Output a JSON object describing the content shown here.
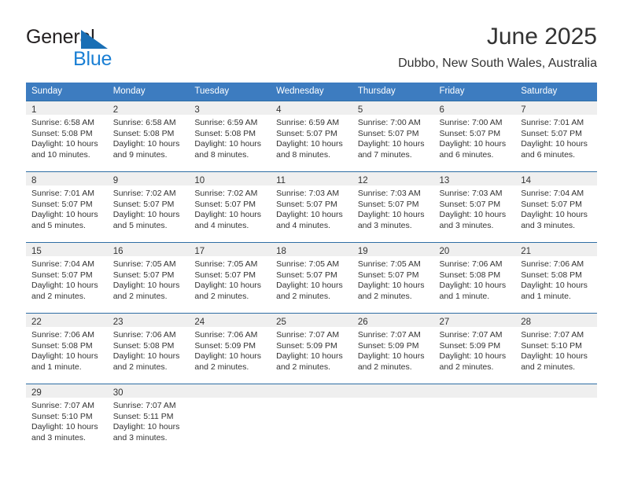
{
  "brand": {
    "name_part1": "General",
    "name_part2": "Blue",
    "logo_icon": "triangle-flag-icon",
    "accent_color": "#1a7fd4"
  },
  "header": {
    "title": "June 2025",
    "location": "Dubbo, New South Wales, Australia"
  },
  "theme": {
    "header_bg": "#3d7cc0",
    "row_border": "#2e6da4",
    "day_band_bg": "#efefef",
    "text_color": "#333333"
  },
  "calendar": {
    "weekday_headers": [
      "Sunday",
      "Monday",
      "Tuesday",
      "Wednesday",
      "Thursday",
      "Friday",
      "Saturday"
    ],
    "weeks": [
      [
        {
          "day": "1",
          "sunrise": "Sunrise: 6:58 AM",
          "sunset": "Sunset: 5:08 PM",
          "daylight_1": "Daylight: 10 hours",
          "daylight_2": "and 10 minutes."
        },
        {
          "day": "2",
          "sunrise": "Sunrise: 6:58 AM",
          "sunset": "Sunset: 5:08 PM",
          "daylight_1": "Daylight: 10 hours",
          "daylight_2": "and 9 minutes."
        },
        {
          "day": "3",
          "sunrise": "Sunrise: 6:59 AM",
          "sunset": "Sunset: 5:08 PM",
          "daylight_1": "Daylight: 10 hours",
          "daylight_2": "and 8 minutes."
        },
        {
          "day": "4",
          "sunrise": "Sunrise: 6:59 AM",
          "sunset": "Sunset: 5:07 PM",
          "daylight_1": "Daylight: 10 hours",
          "daylight_2": "and 8 minutes."
        },
        {
          "day": "5",
          "sunrise": "Sunrise: 7:00 AM",
          "sunset": "Sunset: 5:07 PM",
          "daylight_1": "Daylight: 10 hours",
          "daylight_2": "and 7 minutes."
        },
        {
          "day": "6",
          "sunrise": "Sunrise: 7:00 AM",
          "sunset": "Sunset: 5:07 PM",
          "daylight_1": "Daylight: 10 hours",
          "daylight_2": "and 6 minutes."
        },
        {
          "day": "7",
          "sunrise": "Sunrise: 7:01 AM",
          "sunset": "Sunset: 5:07 PM",
          "daylight_1": "Daylight: 10 hours",
          "daylight_2": "and 6 minutes."
        }
      ],
      [
        {
          "day": "8",
          "sunrise": "Sunrise: 7:01 AM",
          "sunset": "Sunset: 5:07 PM",
          "daylight_1": "Daylight: 10 hours",
          "daylight_2": "and 5 minutes."
        },
        {
          "day": "9",
          "sunrise": "Sunrise: 7:02 AM",
          "sunset": "Sunset: 5:07 PM",
          "daylight_1": "Daylight: 10 hours",
          "daylight_2": "and 5 minutes."
        },
        {
          "day": "10",
          "sunrise": "Sunrise: 7:02 AM",
          "sunset": "Sunset: 5:07 PM",
          "daylight_1": "Daylight: 10 hours",
          "daylight_2": "and 4 minutes."
        },
        {
          "day": "11",
          "sunrise": "Sunrise: 7:03 AM",
          "sunset": "Sunset: 5:07 PM",
          "daylight_1": "Daylight: 10 hours",
          "daylight_2": "and 4 minutes."
        },
        {
          "day": "12",
          "sunrise": "Sunrise: 7:03 AM",
          "sunset": "Sunset: 5:07 PM",
          "daylight_1": "Daylight: 10 hours",
          "daylight_2": "and 3 minutes."
        },
        {
          "day": "13",
          "sunrise": "Sunrise: 7:03 AM",
          "sunset": "Sunset: 5:07 PM",
          "daylight_1": "Daylight: 10 hours",
          "daylight_2": "and 3 minutes."
        },
        {
          "day": "14",
          "sunrise": "Sunrise: 7:04 AM",
          "sunset": "Sunset: 5:07 PM",
          "daylight_1": "Daylight: 10 hours",
          "daylight_2": "and 3 minutes."
        }
      ],
      [
        {
          "day": "15",
          "sunrise": "Sunrise: 7:04 AM",
          "sunset": "Sunset: 5:07 PM",
          "daylight_1": "Daylight: 10 hours",
          "daylight_2": "and 2 minutes."
        },
        {
          "day": "16",
          "sunrise": "Sunrise: 7:05 AM",
          "sunset": "Sunset: 5:07 PM",
          "daylight_1": "Daylight: 10 hours",
          "daylight_2": "and 2 minutes."
        },
        {
          "day": "17",
          "sunrise": "Sunrise: 7:05 AM",
          "sunset": "Sunset: 5:07 PM",
          "daylight_1": "Daylight: 10 hours",
          "daylight_2": "and 2 minutes."
        },
        {
          "day": "18",
          "sunrise": "Sunrise: 7:05 AM",
          "sunset": "Sunset: 5:07 PM",
          "daylight_1": "Daylight: 10 hours",
          "daylight_2": "and 2 minutes."
        },
        {
          "day": "19",
          "sunrise": "Sunrise: 7:05 AM",
          "sunset": "Sunset: 5:07 PM",
          "daylight_1": "Daylight: 10 hours",
          "daylight_2": "and 2 minutes."
        },
        {
          "day": "20",
          "sunrise": "Sunrise: 7:06 AM",
          "sunset": "Sunset: 5:08 PM",
          "daylight_1": "Daylight: 10 hours",
          "daylight_2": "and 1 minute."
        },
        {
          "day": "21",
          "sunrise": "Sunrise: 7:06 AM",
          "sunset": "Sunset: 5:08 PM",
          "daylight_1": "Daylight: 10 hours",
          "daylight_2": "and 1 minute."
        }
      ],
      [
        {
          "day": "22",
          "sunrise": "Sunrise: 7:06 AM",
          "sunset": "Sunset: 5:08 PM",
          "daylight_1": "Daylight: 10 hours",
          "daylight_2": "and 1 minute."
        },
        {
          "day": "23",
          "sunrise": "Sunrise: 7:06 AM",
          "sunset": "Sunset: 5:08 PM",
          "daylight_1": "Daylight: 10 hours",
          "daylight_2": "and 2 minutes."
        },
        {
          "day": "24",
          "sunrise": "Sunrise: 7:06 AM",
          "sunset": "Sunset: 5:09 PM",
          "daylight_1": "Daylight: 10 hours",
          "daylight_2": "and 2 minutes."
        },
        {
          "day": "25",
          "sunrise": "Sunrise: 7:07 AM",
          "sunset": "Sunset: 5:09 PM",
          "daylight_1": "Daylight: 10 hours",
          "daylight_2": "and 2 minutes."
        },
        {
          "day": "26",
          "sunrise": "Sunrise: 7:07 AM",
          "sunset": "Sunset: 5:09 PM",
          "daylight_1": "Daylight: 10 hours",
          "daylight_2": "and 2 minutes."
        },
        {
          "day": "27",
          "sunrise": "Sunrise: 7:07 AM",
          "sunset": "Sunset: 5:09 PM",
          "daylight_1": "Daylight: 10 hours",
          "daylight_2": "and 2 minutes."
        },
        {
          "day": "28",
          "sunrise": "Sunrise: 7:07 AM",
          "sunset": "Sunset: 5:10 PM",
          "daylight_1": "Daylight: 10 hours",
          "daylight_2": "and 2 minutes."
        }
      ],
      [
        {
          "day": "29",
          "sunrise": "Sunrise: 7:07 AM",
          "sunset": "Sunset: 5:10 PM",
          "daylight_1": "Daylight: 10 hours",
          "daylight_2": "and 3 minutes."
        },
        {
          "day": "30",
          "sunrise": "Sunrise: 7:07 AM",
          "sunset": "Sunset: 5:11 PM",
          "daylight_1": "Daylight: 10 hours",
          "daylight_2": "and 3 minutes."
        },
        {
          "day": "",
          "sunrise": "",
          "sunset": "",
          "daylight_1": "",
          "daylight_2": ""
        },
        {
          "day": "",
          "sunrise": "",
          "sunset": "",
          "daylight_1": "",
          "daylight_2": ""
        },
        {
          "day": "",
          "sunrise": "",
          "sunset": "",
          "daylight_1": "",
          "daylight_2": ""
        },
        {
          "day": "",
          "sunrise": "",
          "sunset": "",
          "daylight_1": "",
          "daylight_2": ""
        },
        {
          "day": "",
          "sunrise": "",
          "sunset": "",
          "daylight_1": "",
          "daylight_2": ""
        }
      ]
    ]
  }
}
